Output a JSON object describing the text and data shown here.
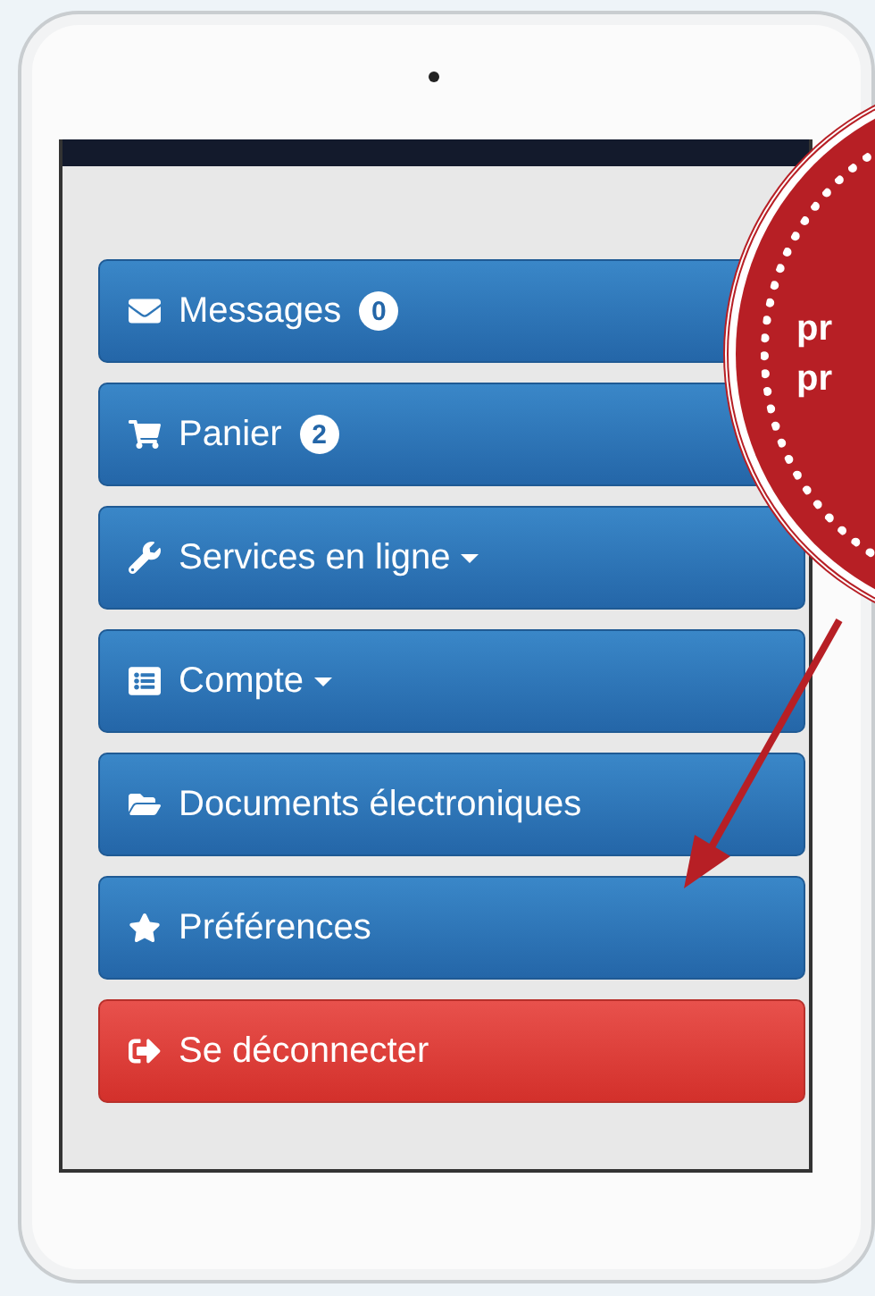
{
  "menu": [
    {
      "label": "Messages",
      "badge": "0",
      "dropdown": false,
      "kind": "primary"
    },
    {
      "label": "Panier",
      "badge": "2",
      "dropdown": false,
      "kind": "primary"
    },
    {
      "label": "Services en ligne",
      "dropdown": true,
      "kind": "primary"
    },
    {
      "label": "Compte",
      "dropdown": true,
      "kind": "primary"
    },
    {
      "label": "Documents électroniques",
      "dropdown": false,
      "kind": "primary"
    },
    {
      "label": "Préférences",
      "dropdown": false,
      "kind": "primary"
    },
    {
      "label": "Se déconnecter",
      "dropdown": false,
      "kind": "danger"
    }
  ],
  "callout": {
    "lines": [
      "pr",
      "pr"
    ]
  }
}
